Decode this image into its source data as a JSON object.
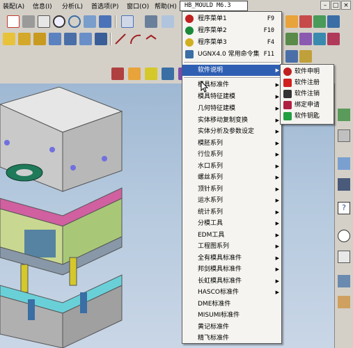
{
  "menubar": {
    "items": [
      "装配(A)",
      "信息(I)",
      "分析(L)",
      "首选项(P)",
      "窗口(O)",
      "帮助(H)"
    ],
    "active": "HB_MOULD M6.3"
  },
  "hb_menu": {
    "items": [
      {
        "label": "程序菜单1",
        "shortcut": "F9"
      },
      {
        "label": "程序菜单2",
        "shortcut": "F10"
      },
      {
        "label": "程序菜单3",
        "shortcut": "F4"
      },
      {
        "label": "UGNX4.0 常用命令集",
        "shortcut": "F11"
      }
    ],
    "group2": [
      "软件说明",
      "模具标准件",
      "模具特征建模",
      "几何特征建模",
      "实体移动复制变换",
      "实体分析及参数设定",
      "模胚系列",
      "行位系列",
      "水口系列",
      "螺丝系列",
      "顶针系列",
      "运水系列",
      "统计系列",
      "分模工具",
      "EDM工具",
      "工程图系列",
      "全有模具标准件",
      "邦剑模具标准件",
      "长虹模具标准件",
      "HASCO标准件",
      "DME标准件",
      "MISUMI标准件",
      "黄记标准件",
      "精飞标准件"
    ]
  },
  "submenu": {
    "items": [
      "软件申明",
      "软件注册",
      "软件注销",
      "绑定申请",
      "软件钥匙"
    ]
  },
  "colors": {
    "highlight": "#2f5fb3",
    "menu_bg": "#f5f4f0",
    "toolbar_bg": "#d4d0c8",
    "viewport_bg": "#b5c9de"
  }
}
